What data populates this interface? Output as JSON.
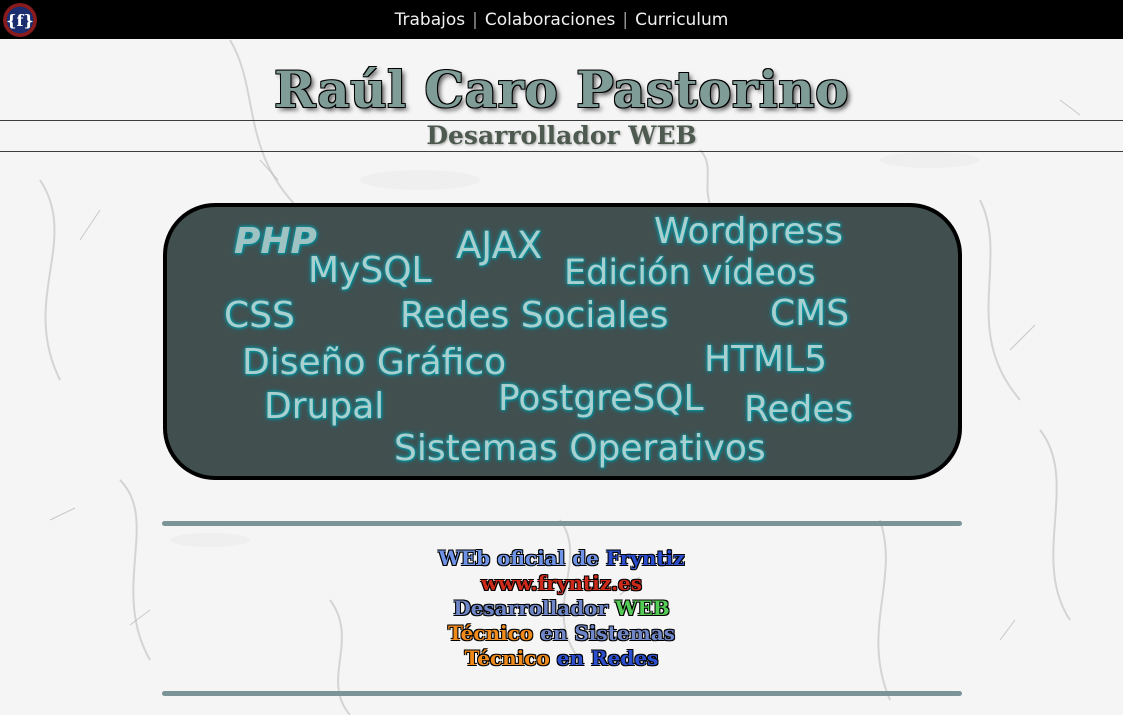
{
  "header": {
    "logo_glyph": "{f}",
    "nav": [
      {
        "label": "Trabajos"
      },
      {
        "label": "Colaboraciones"
      },
      {
        "label": "Curriculum"
      }
    ],
    "separator": "|"
  },
  "hero": {
    "title": "Raúl Caro Pastorino",
    "subtitle": "Desarrollador WEB"
  },
  "skills": [
    {
      "label": "PHP"
    },
    {
      "label": "AJAX"
    },
    {
      "label": "Wordpress"
    },
    {
      "label": "MySQL"
    },
    {
      "label": "Edición vídeos"
    },
    {
      "label": "CSS"
    },
    {
      "label": "Redes Sociales"
    },
    {
      "label": "CMS"
    },
    {
      "label": "Diseño Gráfico"
    },
    {
      "label": "HTML5"
    },
    {
      "label": "Drupal"
    },
    {
      "label": "PostgreSQL"
    },
    {
      "label": "Redes"
    },
    {
      "label": "Sistemas Operativos"
    }
  ],
  "footer": {
    "line1_a": "WEb oficial de",
    "line1_b": "Fryntiz",
    "line2": "www.fryntiz.es",
    "line3_a": "Desarrollador",
    "line3_b": "WEB",
    "line4_a": "Técnico",
    "line4_b": "en Sistemas",
    "line5_a": "Técnico",
    "line5_b": "en Redes"
  },
  "colors": {
    "topbar": "#000000",
    "skills_box": "#414f4f",
    "skill_text": "#a9cfcf",
    "title": "#7f9c97",
    "divider_bar": "#7a9497"
  }
}
